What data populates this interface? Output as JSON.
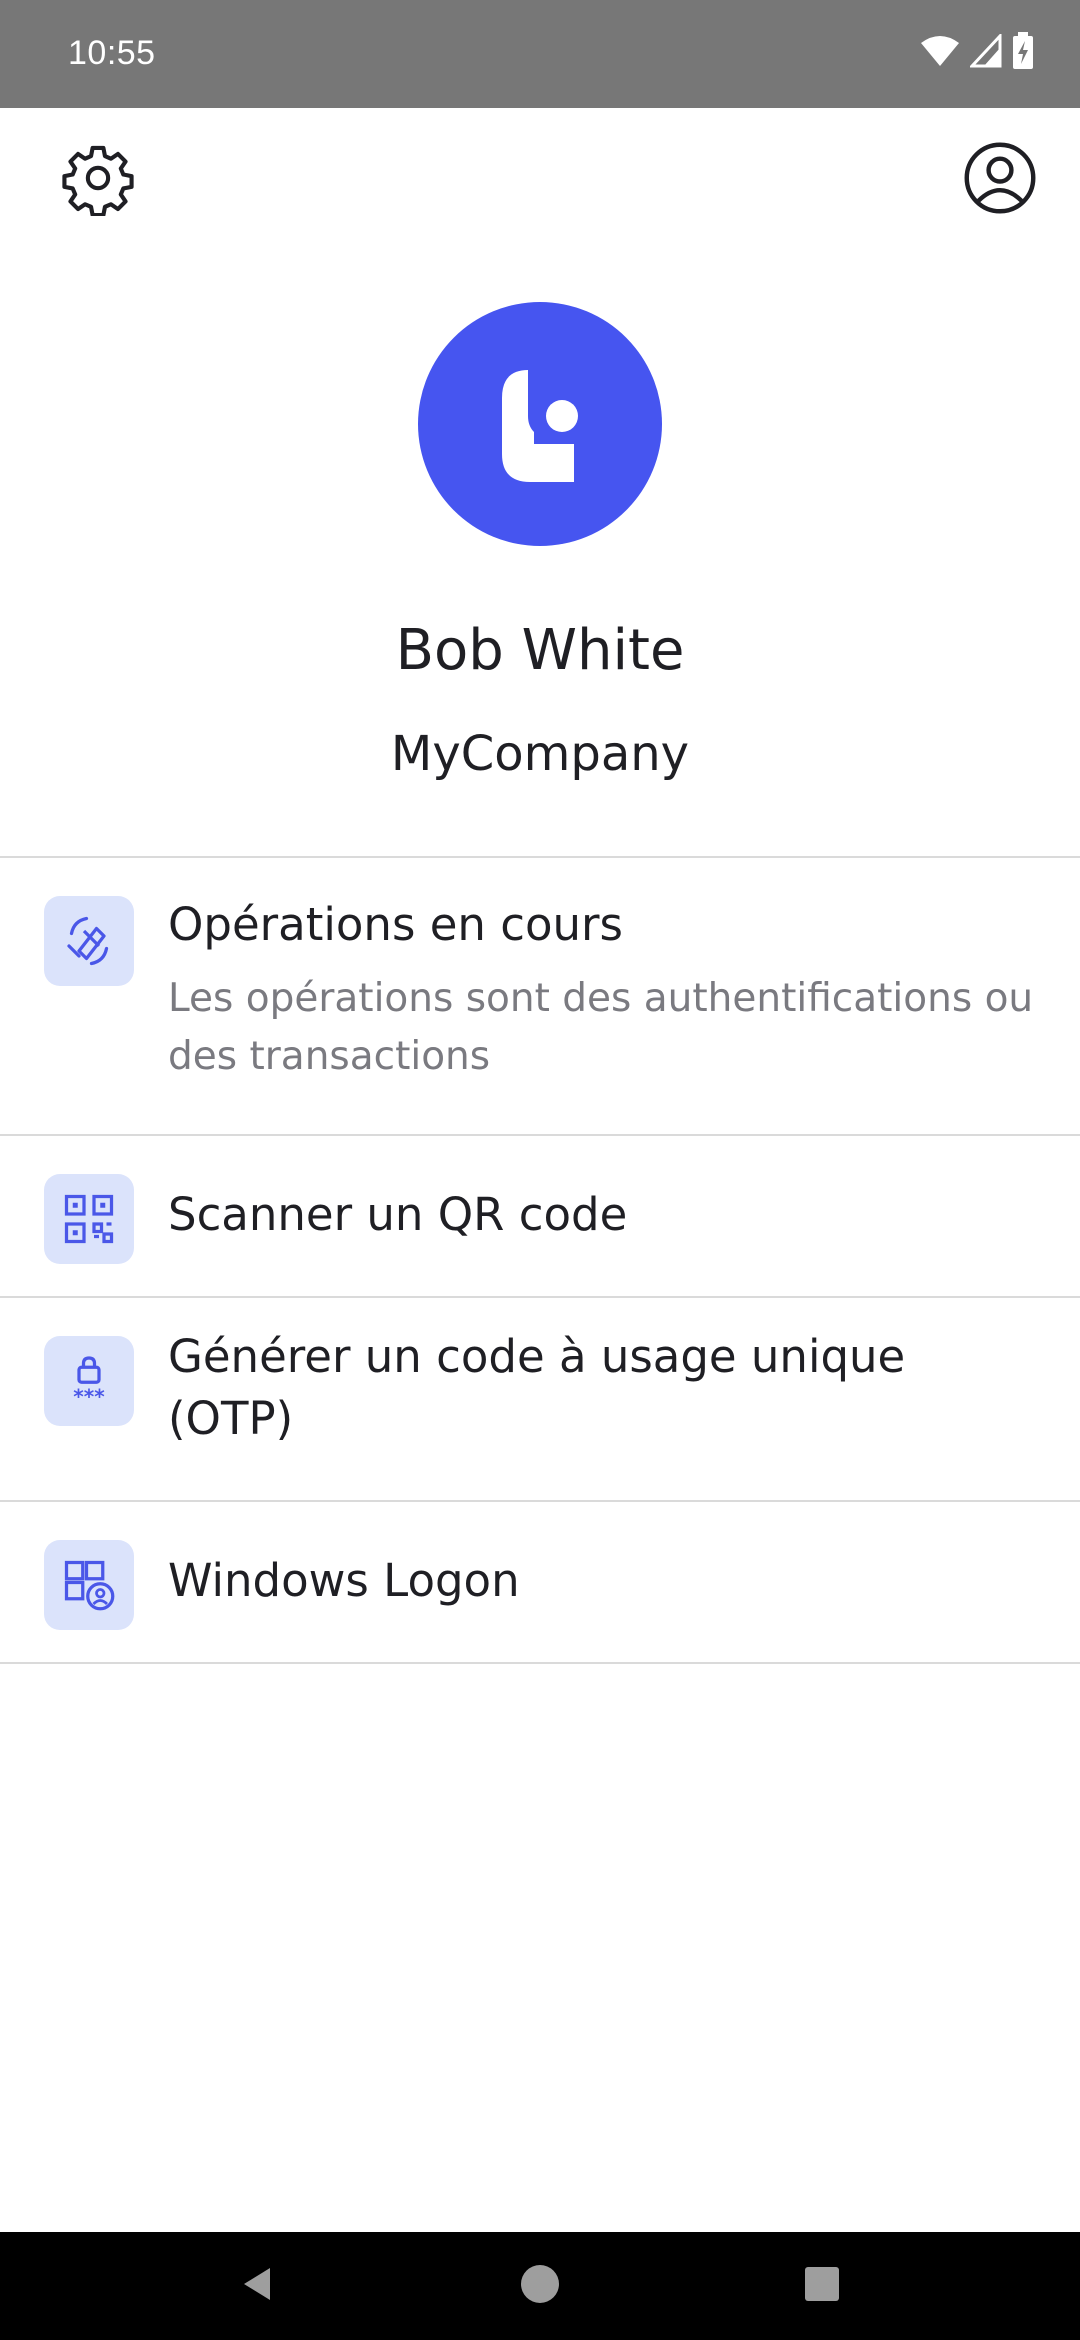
{
  "status_bar": {
    "time": "10:55",
    "icons": [
      "wifi-icon",
      "cell-signal-icon",
      "battery-charging-icon"
    ]
  },
  "top_bar": {
    "left_icon": "gear-icon",
    "right_icon": "account-circle-icon"
  },
  "profile": {
    "logo_icon": "brand-logo-icon",
    "name": "Bob White",
    "company": "MyCompany"
  },
  "menu": {
    "items": [
      {
        "icon": "operations-icon",
        "title": "Opérations en cours",
        "subtitle": "Les opérations sont des authentifications ou des transactions"
      },
      {
        "icon": "qr-code-icon",
        "title": "Scanner un QR code"
      },
      {
        "icon": "otp-lock-icon",
        "title": "Générer un code à usage unique (OTP)"
      },
      {
        "icon": "windows-logon-icon",
        "title": "Windows Logon"
      }
    ]
  },
  "nav_bar": {
    "icons": [
      "back-icon",
      "home-icon",
      "recent-apps-icon"
    ]
  },
  "colors": {
    "status_bar": "#777777",
    "brand": "#4655f0",
    "icon_tile": "#dbe3fb",
    "icon_stroke": "#4a57e8",
    "divider": "#dadada",
    "subtitle": "#7a7a80"
  }
}
